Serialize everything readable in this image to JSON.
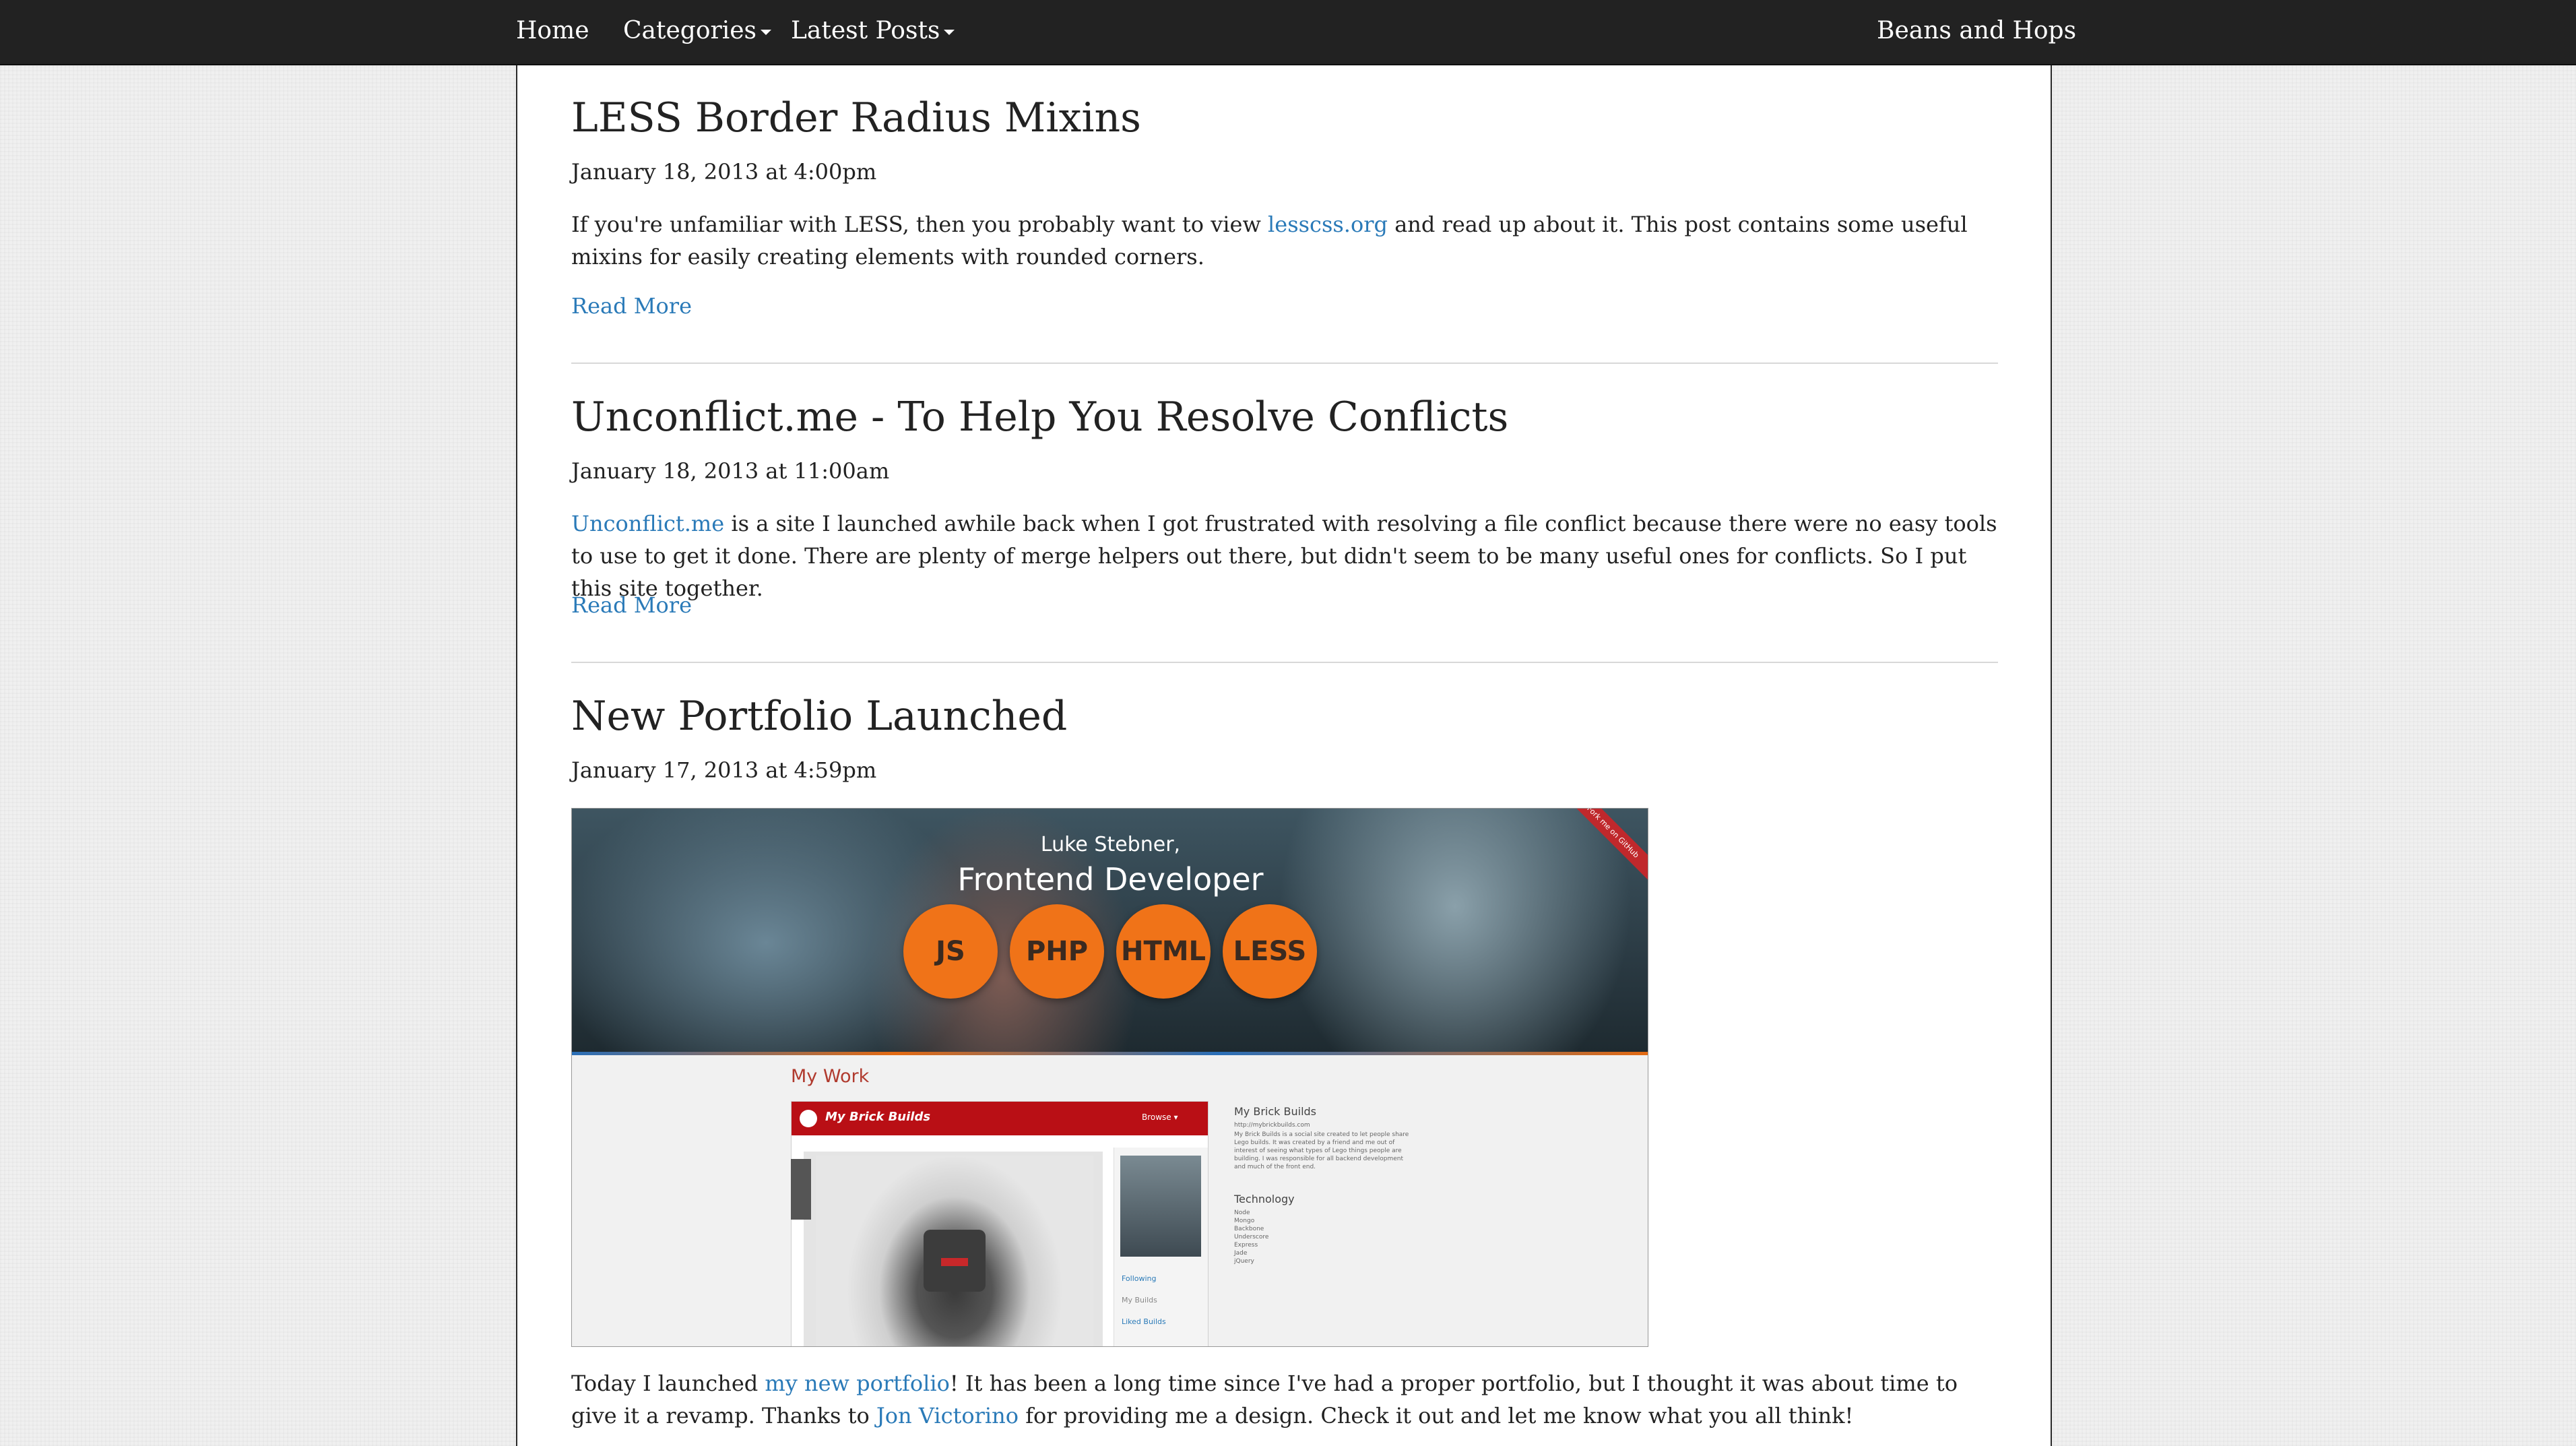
{
  "navbar": {
    "home": "Home",
    "categories": "Categories",
    "latest_posts": "Latest Posts",
    "brand": "Beans and Hops"
  },
  "posts": [
    {
      "title": "LESS Border Radius Mixins",
      "date": "January 18, 2013 at 4:00pm",
      "body_before": "If you're unfamiliar with LESS, then you probably want to view ",
      "link": "lesscss.org",
      "body_after": " and read up about it. This post contains some useful mixins for easily creating elements with rounded corners.",
      "read_more": "Read More"
    },
    {
      "title": "Unconflict.me - To Help You Resolve Conflicts",
      "date": "January 18, 2013 at 11:00am",
      "link": "Unconflict.me",
      "body_after": " is a site I launched awhile back when I got frustrated with resolving a file conflict because there were no easy tools to use to get it done. There are plenty of merge helpers out there, but didn't seem to be many useful ones for conflicts. So I put this site together.",
      "read_more": "Read More"
    },
    {
      "title": "New Portfolio Launched",
      "date": "January 17, 2013 at 4:59pm",
      "body_before": "Today I launched ",
      "link1": "my new portfolio",
      "body_middle": "! It has been a long time since I've had a proper portfolio, but I thought it was about time to give it a revamp. Thanks to ",
      "link2": "Jon Victorino",
      "body_after": " for providing me a design. Check it out and let me know what you all think!"
    }
  ],
  "portfolio_image": {
    "name": "Luke Stebner,",
    "role": "Frontend Developer",
    "skills": [
      "JS",
      "PHP",
      "HTML",
      "LESS"
    ],
    "ribbon": "Fork me on GitHub",
    "section": "My Work",
    "app_title": "My Brick Builds",
    "app_browse": "Browse ▾",
    "side_links": [
      "Following",
      "My Builds",
      "Liked Builds"
    ],
    "project_title": "My Brick Builds",
    "project_url": "http://mybrickbuilds.com",
    "project_desc": [
      "My Brick Builds is a social site created to let people share",
      "Lego builds. It was created by a friend and me out of",
      "interest of seeing what types of Lego things people are",
      "building. I was responsible for all backend development",
      "and much of the front end."
    ],
    "tech_title": "Technology",
    "tech_list": [
      "Node",
      "Mongo",
      "Backbone",
      "Underscore",
      "Express",
      "Jade",
      "jQuery"
    ]
  },
  "colors": {
    "navbar_bg": "#222222",
    "link": "#2a7ab8",
    "skill_circle": "#f07318",
    "app_bar": "#b90f15"
  }
}
